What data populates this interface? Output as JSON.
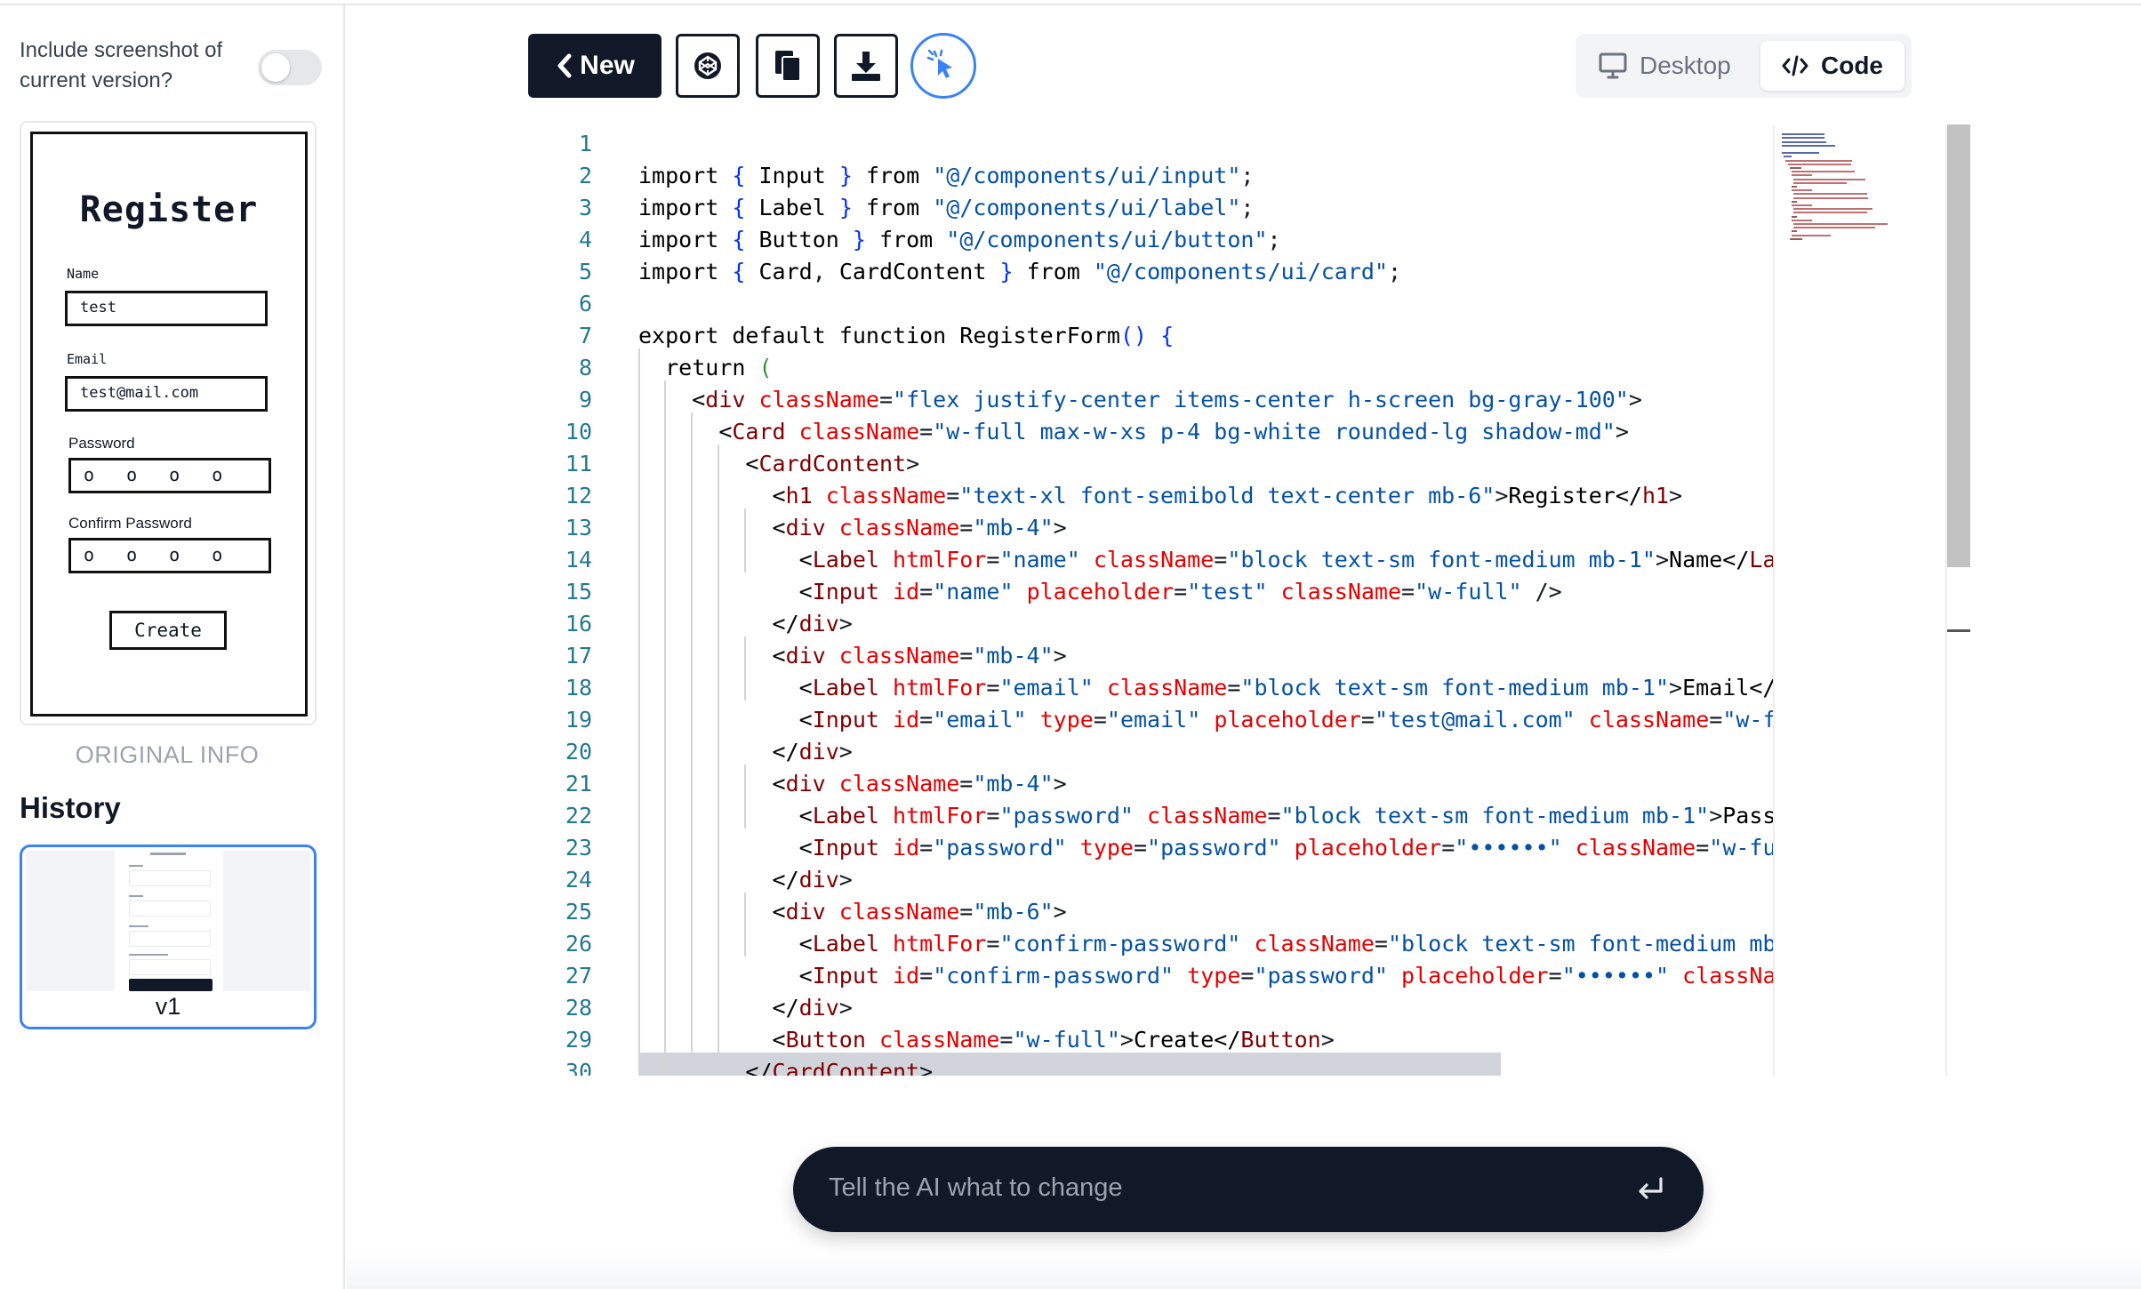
{
  "sidebar": {
    "include_label": "Include screenshot of current version?",
    "preview": {
      "title": "Register",
      "name_label": "Name",
      "name_value": "test",
      "email_label": "Email",
      "email_value": "test@mail.com",
      "password_label": "Password",
      "password_value": "o o o o",
      "confirm_label": "Confirm Password",
      "confirm_value": "o o o o",
      "button_label": "Create"
    },
    "original_info_label": "ORIGINAL INFO",
    "history_title": "History",
    "history_items": [
      {
        "label": "v1"
      }
    ]
  },
  "toolbar": {
    "new_label": "New",
    "icons": [
      "codepen-icon",
      "copy-icon",
      "download-icon",
      "cursor-click-icon"
    ],
    "view_desktop_label": "Desktop",
    "view_code_label": "Code",
    "active_view": "Code"
  },
  "editor": {
    "lines": [
      "",
      "import { Input } from \"@/components/ui/input\";",
      "import { Label } from \"@/components/ui/label\";",
      "import { Button } from \"@/components/ui/button\";",
      "import { Card, CardContent } from \"@/components/ui/card\";",
      "",
      "export default function RegisterForm() {",
      "  return (",
      "    <div className=\"flex justify-center items-center h-screen bg-gray-100\">",
      "      <Card className=\"w-full max-w-xs p-4 bg-white rounded-lg shadow-md\">",
      "        <CardContent>",
      "          <h1 className=\"text-xl font-semibold text-center mb-6\">Register</h1>",
      "          <div className=\"mb-4\">",
      "            <Label htmlFor=\"name\" className=\"block text-sm font-medium mb-1\">Name</Label>",
      "            <Input id=\"name\" placeholder=\"test\" className=\"w-full\" />",
      "          </div>",
      "          <div className=\"mb-4\">",
      "            <Label htmlFor=\"email\" className=\"block text-sm font-medium mb-1\">Email</Label>",
      "            <Input id=\"email\" type=\"email\" placeholder=\"test@mail.com\" className=\"w-full\" />",
      "          </div>",
      "          <div className=\"mb-4\">",
      "            <Label htmlFor=\"password\" className=\"block text-sm font-medium mb-1\">Password</Label>",
      "            <Input id=\"password\" type=\"password\" placeholder=\"••••••\" className=\"w-full\" />",
      "          </div>",
      "          <div className=\"mb-6\">",
      "            <Label htmlFor=\"confirm-password\" className=\"block text-sm font-medium mb-1\">Confirm Password</Label>",
      "            <Input id=\"confirm-password\" type=\"password\" placeholder=\"••••••\" className=\"w-full\" />",
      "          </div>",
      "          <Button className=\"w-full\">Create</Button>",
      "        </CardContent>"
    ]
  },
  "prompt": {
    "placeholder": "Tell the AI what to change",
    "submit_icon": "enter-icon"
  },
  "colors": {
    "dark": "#111827",
    "accent": "#3b82f6",
    "line_number": "#237893",
    "keyword": "#000000",
    "brace": "#0431fa",
    "tag": "#800000",
    "attribute": "#e50000",
    "string": "#0451a5"
  }
}
